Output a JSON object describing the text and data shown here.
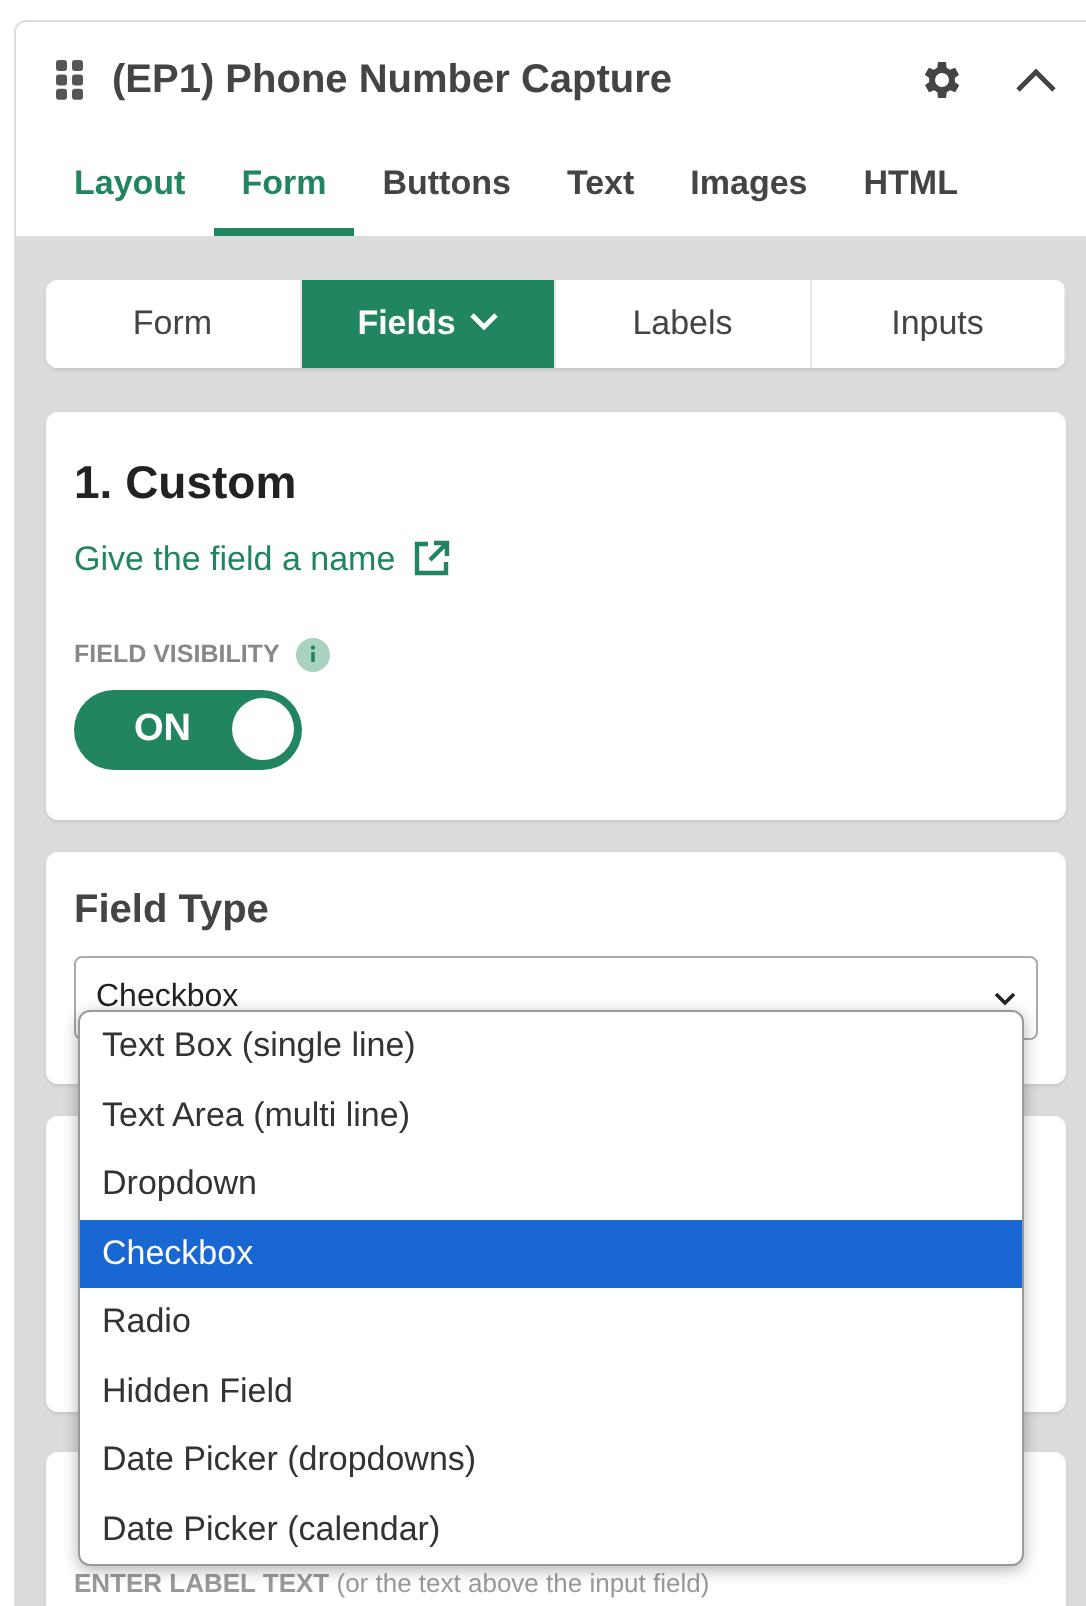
{
  "panel": {
    "title": "(EP1) Phone Number Capture"
  },
  "tabs": [
    {
      "label": "Layout",
      "selected": false
    },
    {
      "label": "Form",
      "selected": true
    },
    {
      "label": "Buttons",
      "selected": false
    },
    {
      "label": "Text",
      "selected": false
    },
    {
      "label": "Images",
      "selected": false
    },
    {
      "label": "HTML",
      "selected": false
    }
  ],
  "subtabs": [
    {
      "label": "Form",
      "selected": false,
      "dropdown": false
    },
    {
      "label": "Fields",
      "selected": true,
      "dropdown": true
    },
    {
      "label": "Labels",
      "selected": false,
      "dropdown": false
    },
    {
      "label": "Inputs",
      "selected": false,
      "dropdown": false
    }
  ],
  "custom_card": {
    "heading": "1. Custom",
    "link": "Give the field a name",
    "visibility_label": "FIELD VISIBILITY",
    "toggle": {
      "label": "ON",
      "on": true
    }
  },
  "field_type": {
    "heading": "Field Type",
    "value": "Checkbox",
    "options": [
      {
        "label": "Text Box (single line)",
        "selected": false
      },
      {
        "label": "Text Area (multi line)",
        "selected": false
      },
      {
        "label": "Dropdown",
        "selected": false
      },
      {
        "label": "Checkbox",
        "selected": true
      },
      {
        "label": "Radio",
        "selected": false
      },
      {
        "label": "Hidden Field",
        "selected": false
      },
      {
        "label": "Date Picker (dropdowns)",
        "selected": false
      },
      {
        "label": "Date Picker (calendar)",
        "selected": false
      }
    ]
  },
  "label_card": {
    "hint": "ENTER LABEL TEXT",
    "note": "(or the text above the input field)"
  }
}
